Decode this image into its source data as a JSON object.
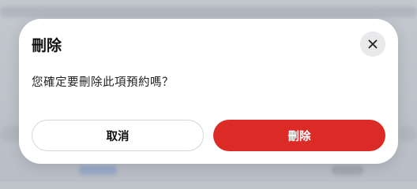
{
  "dialog": {
    "title": "刪除",
    "message": "您確定要刪除此項預約嗎？",
    "close_icon": "close-icon",
    "cancel_label": "取消",
    "delete_label": "刪除"
  },
  "colors": {
    "danger": "#dc2a27",
    "close_bg": "#e9e9eb",
    "overlay": "#bfc3ca"
  }
}
